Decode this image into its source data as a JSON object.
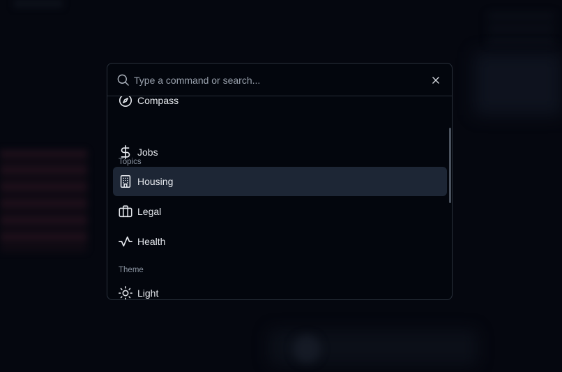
{
  "search": {
    "placeholder": "Type a command or search...",
    "value": ""
  },
  "groups": {
    "topics_heading": "Topics",
    "theme_heading": "Theme"
  },
  "items": {
    "compass": "Compass",
    "jobs": "Jobs",
    "housing": "Housing",
    "legal": "Legal",
    "health": "Health",
    "light": "Light"
  },
  "icons": {
    "search": "search-icon",
    "close": "close-icon",
    "compass": "compass-icon",
    "jobs": "dollar-icon",
    "housing": "building-icon",
    "legal": "briefcase-icon",
    "health": "activity-icon",
    "light": "sun-icon"
  },
  "colors": {
    "background": "#05070f",
    "palette_background": "#03060d",
    "border": "#2a313c",
    "selected_background": "#1d2635",
    "text": "#e6e9ee",
    "muted_text": "#8a93a0"
  },
  "selected_item": "Housing"
}
